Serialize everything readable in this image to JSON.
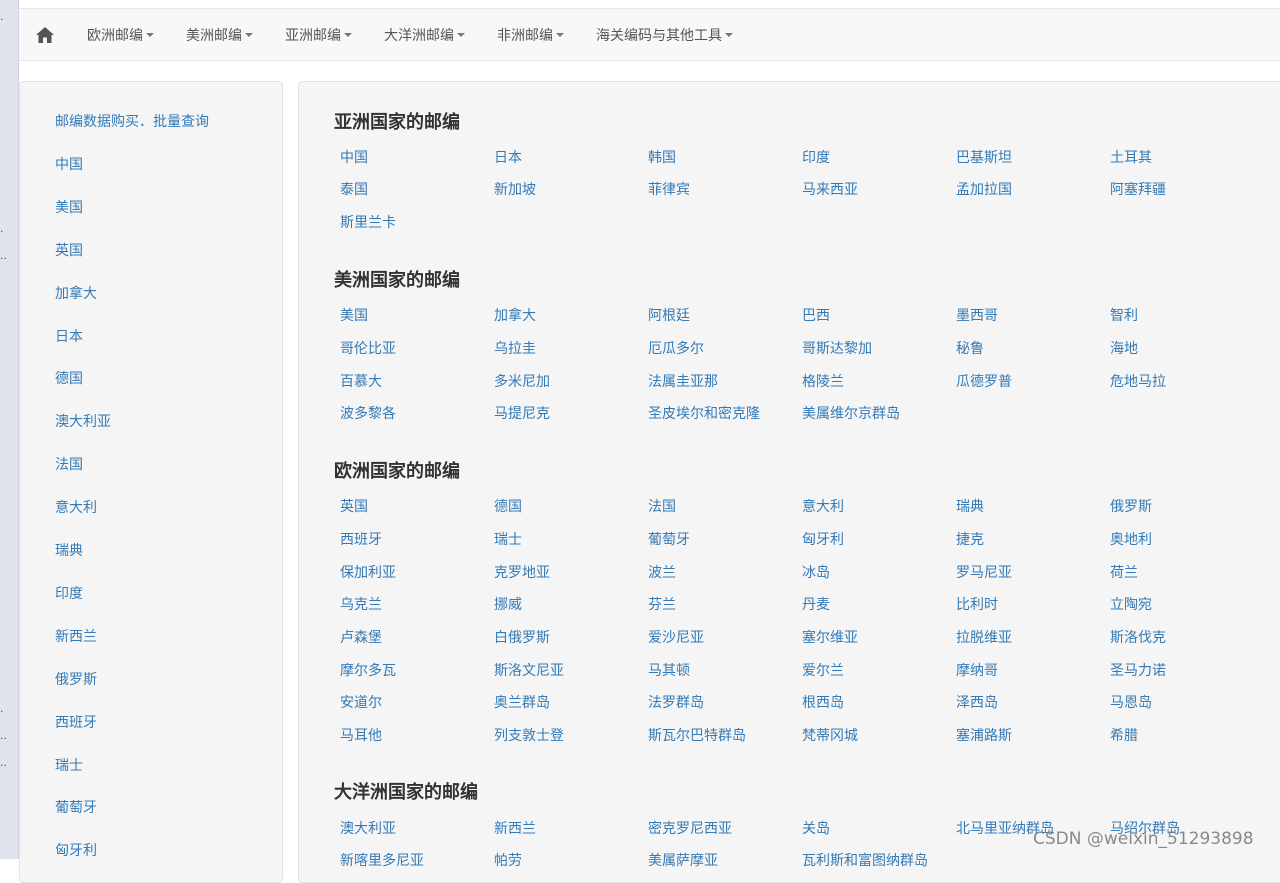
{
  "nav": {
    "home_icon": "home-icon",
    "items": [
      {
        "label": "欧洲邮编"
      },
      {
        "label": "美洲邮编"
      },
      {
        "label": "亚洲邮编"
      },
      {
        "label": "大洋洲邮编"
      },
      {
        "label": "非洲邮编"
      },
      {
        "label": "海关编码与其他工具"
      }
    ]
  },
  "sidebar": {
    "links": [
      "邮编数据购买．批量查询",
      "中国",
      "美国",
      "英国",
      "加拿大",
      "日本",
      "德国",
      "澳大利亚",
      "法国",
      "意大利",
      "瑞典",
      "印度",
      "新西兰",
      "俄罗斯",
      "西班牙",
      "瑞士",
      "葡萄牙",
      "匈牙利"
    ]
  },
  "sections": [
    {
      "title": "亚洲国家的邮编",
      "countries": [
        "中国",
        "日本",
        "韩国",
        "印度",
        "巴基斯坦",
        "土耳其",
        "泰国",
        "新加坡",
        "菲律宾",
        "马来西亚",
        "孟加拉国",
        "阿塞拜疆",
        "斯里兰卡"
      ]
    },
    {
      "title": "美洲国家的邮编",
      "countries": [
        "美国",
        "加拿大",
        "阿根廷",
        "巴西",
        "墨西哥",
        "智利",
        "哥伦比亚",
        "乌拉圭",
        "厄瓜多尔",
        "哥斯达黎加",
        "秘鲁",
        "海地",
        "百慕大",
        "多米尼加",
        "法属圭亚那",
        "格陵兰",
        "瓜德罗普",
        "危地马拉",
        "波多黎各",
        "马提尼克",
        "圣皮埃尔和密克隆",
        "美属维尔京群岛"
      ]
    },
    {
      "title": "欧洲国家的邮编",
      "countries": [
        "英国",
        "德国",
        "法国",
        "意大利",
        "瑞典",
        "俄罗斯",
        "西班牙",
        "瑞士",
        "葡萄牙",
        "匈牙利",
        "捷克",
        "奥地利",
        "保加利亚",
        "克罗地亚",
        "波兰",
        "冰岛",
        "罗马尼亚",
        "荷兰",
        "乌克兰",
        "挪威",
        "芬兰",
        "丹麦",
        "比利时",
        "立陶宛",
        "卢森堡",
        "白俄罗斯",
        "爱沙尼亚",
        "塞尔维亚",
        "拉脱维亚",
        "斯洛伐克",
        "摩尔多瓦",
        "斯洛文尼亚",
        "马其顿",
        "爱尔兰",
        "摩纳哥",
        "圣马力诺",
        "安道尔",
        "奥兰群岛",
        "法罗群岛",
        "根西岛",
        "泽西岛",
        "马恩岛",
        "马耳他",
        "列支敦士登",
        "斯瓦尔巴特群岛",
        "梵蒂冈城",
        "塞浦路斯",
        "希腊"
      ]
    },
    {
      "title": "大洋洲国家的邮编",
      "countries": [
        "澳大利亚",
        "新西兰",
        "密克罗尼西亚",
        "关岛",
        "北马里亚纳群岛",
        "马绍尔群岛",
        "新喀里多尼亚",
        "帕劳",
        "美属萨摩亚",
        "瓦利斯和富图纳群岛"
      ]
    }
  ],
  "watermark": "CSDN @weixin_51293898",
  "colors": {
    "link": "#337ab7",
    "panel_bg": "#f5f5f5",
    "navbar_bg": "#f8f8f8"
  }
}
